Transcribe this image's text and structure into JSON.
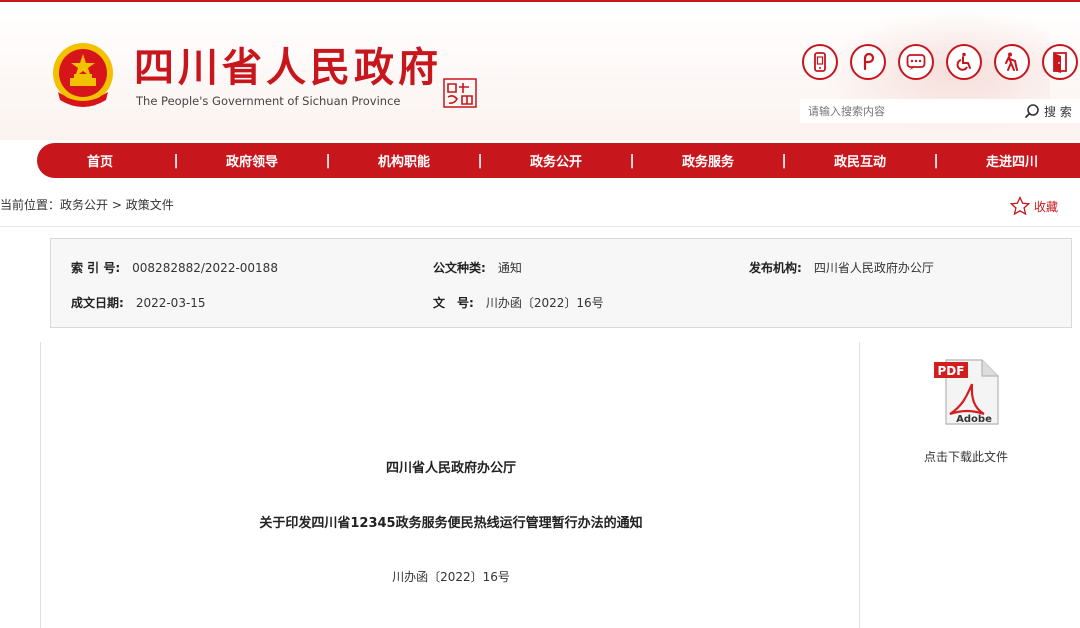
{
  "header": {
    "site_title": "四川省人民政府",
    "site_subtitle": "The People's Government of Sichuan Province",
    "emblem_icon": "national-emblem-icon",
    "seal_icon": "sichuan-china-seal-icon",
    "top_icons": [
      "mobile-icon",
      "weibo-icon",
      "wechat-message-icon",
      "accessibility-wheelchair-icon",
      "elderly-mode-icon",
      "exit-door-icon"
    ],
    "search": {
      "placeholder": "请输入搜索内容",
      "button_label": "搜 索"
    }
  },
  "nav": {
    "items": [
      "首页",
      "政府领导",
      "机构职能",
      "政务公开",
      "政务服务",
      "政民互动",
      "走进四川"
    ],
    "separator": "|"
  },
  "breadcrumb": {
    "prefix": "当前位置：",
    "items": [
      "政务公开",
      "政策文件"
    ],
    "separator": " > "
  },
  "favorite": {
    "label": "收藏"
  },
  "info": {
    "index_label": "索 引 号:",
    "index_value": "008282882/2022-00188",
    "category_label": "公文种类:",
    "category_value": "通知",
    "publisher_label": "发布机构:",
    "publisher_value": "四川省人民政府办公厅",
    "date_label": "成文日期:",
    "date_value": "2022-03-15",
    "docno_label": "文　号:",
    "docno_value": "川办函〔2022〕16号"
  },
  "document": {
    "issuer": "四川省人民政府办公厅",
    "title": "关于印发四川省12345政务服务便民热线运行管理暂行办法的通知",
    "number": "川办函〔2022〕16号"
  },
  "side": {
    "pdf_badge": "PDF",
    "pdf_brand": "Adobe",
    "download_label": "点击下载此文件"
  },
  "colors": {
    "brand_red": "#c8161d",
    "gold": "#f2c100"
  }
}
